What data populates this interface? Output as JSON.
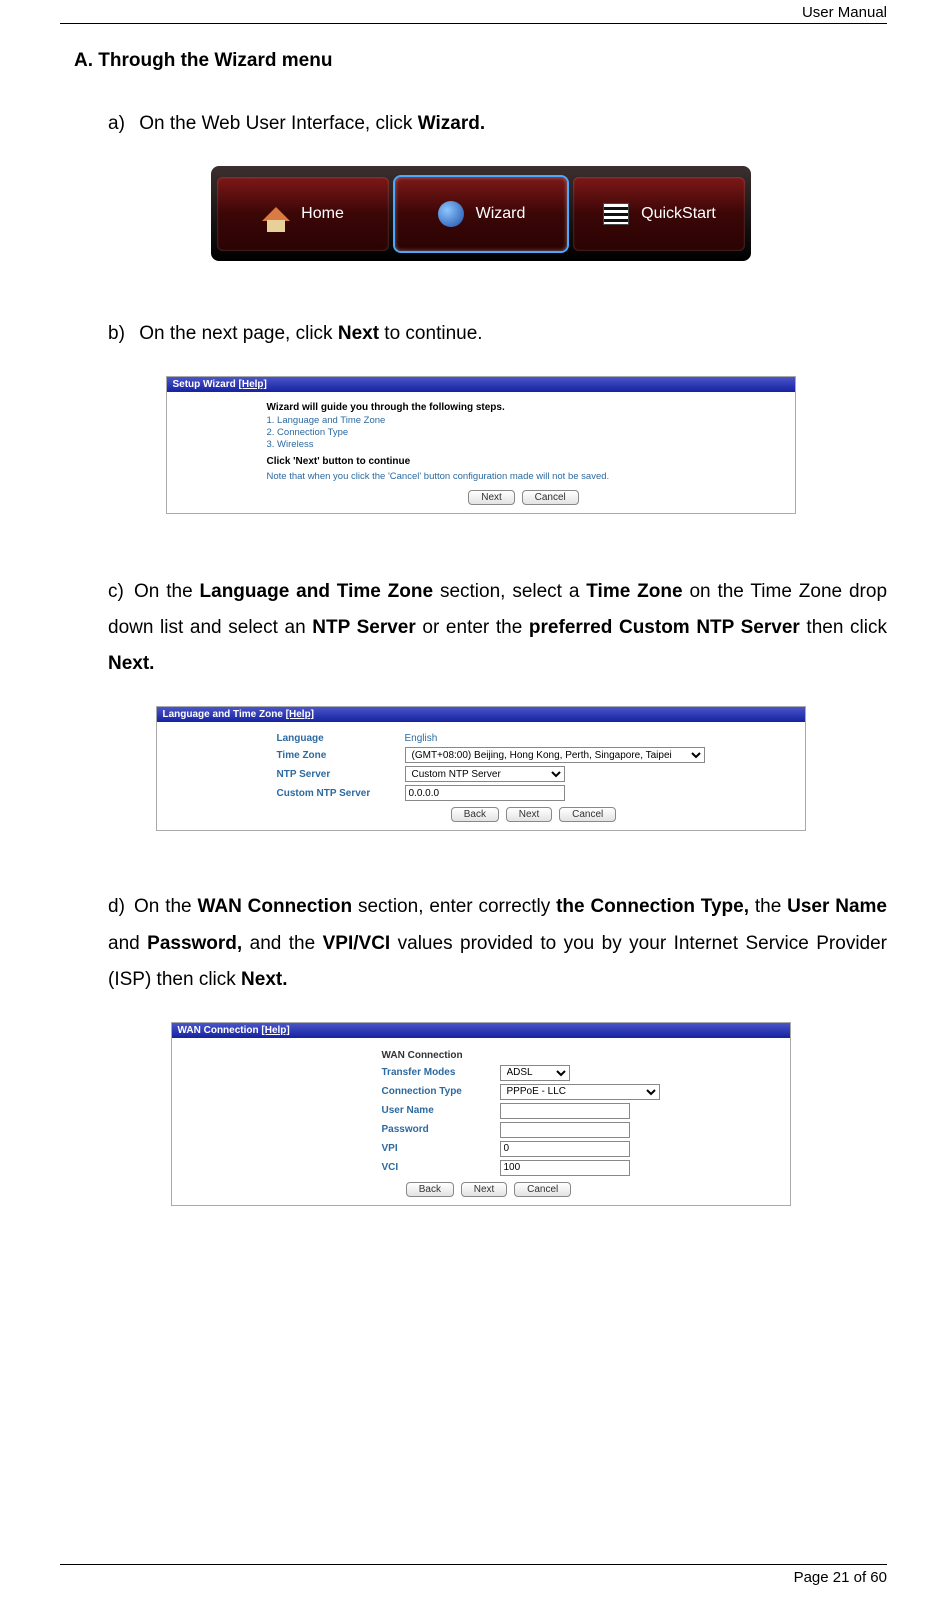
{
  "header": {
    "title": "User Manual"
  },
  "footer": {
    "text": "Page 21 of 60"
  },
  "section": {
    "letter": "A.",
    "title": "Through the Wizard menu"
  },
  "step_a": {
    "marker": "a)",
    "prefix": "On the Web User Interface, click ",
    "bold": "Wizard."
  },
  "navbar": {
    "home": "Home",
    "wizard": "Wizard",
    "quickstart": "QuickStart"
  },
  "step_b": {
    "marker": "b)",
    "prefix": "On the next page, click ",
    "bold": "Next",
    "suffix": " to continue."
  },
  "wizard_panel": {
    "title": "Setup Wizard ",
    "help": "[Help]",
    "heading": "Wizard will guide you through the following steps.",
    "s1": "1. Language and Time Zone",
    "s2": "2. Connection Type",
    "s3": "3. Wireless",
    "click_next": "Click 'Next' button to continue",
    "note": "Note that when you click the 'Cancel' button configuration made will not be saved.",
    "next": "Next",
    "cancel": "Cancel"
  },
  "step_c": {
    "marker": "c)",
    "t1": "On the ",
    "b1": "Language and Time Zone",
    "t2": " section, select a ",
    "b2": "Time Zone",
    "t3": " on the Time Zone drop down list and select an ",
    "b3": "NTP Server",
    "t4": " or enter the ",
    "b4": "preferred Custom NTP Server",
    "t5": " then click ",
    "b5": "Next."
  },
  "tz_panel": {
    "title": "Language and Time Zone ",
    "help": "[Help]",
    "lbl_lang": "Language",
    "val_lang": "English",
    "lbl_tz": "Time Zone",
    "val_tz": "(GMT+08:00) Beijing, Hong Kong, Perth, Singapore, Taipei",
    "lbl_ntp": "NTP Server",
    "val_ntp": "Custom NTP Server",
    "lbl_cntp": "Custom NTP Server",
    "val_cntp": "0.0.0.0",
    "back": "Back",
    "next": "Next",
    "cancel": "Cancel"
  },
  "step_d": {
    "marker": "d)",
    "t1": "On the ",
    "b1": "WAN Connection",
    "t2": " section, enter correctly ",
    "b2": "the Connection Type,",
    "t3": " the ",
    "b3": "User Name",
    "t4": " and ",
    "b4": "Password,",
    "t5": " and the ",
    "b5": "VPI/VCI",
    "t6": " values provided to you by your Internet Service Provider (ISP) then click ",
    "b6": "Next."
  },
  "wan_panel": {
    "title": "WAN Connection ",
    "help": "[Help]",
    "h": "WAN Connection",
    "lbl_tm": "Transfer Modes",
    "val_tm": "ADSL",
    "lbl_ct": "Connection Type",
    "val_ct": "PPPoE - LLC",
    "lbl_un": "User Name",
    "lbl_pw": "Password",
    "lbl_vpi": "VPI",
    "val_vpi": "0",
    "lbl_vci": "VCI",
    "val_vci": "100",
    "back": "Back",
    "next": "Next",
    "cancel": "Cancel"
  }
}
